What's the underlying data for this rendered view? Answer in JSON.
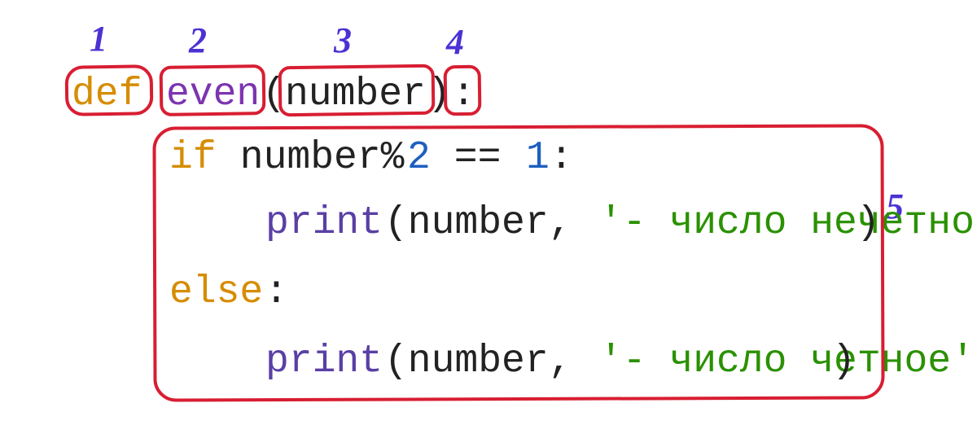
{
  "labels": {
    "l1": "1",
    "l2": "2",
    "l3": "3",
    "l4": "4",
    "l5": "5"
  },
  "code": {
    "def": "def",
    "sp1": " ",
    "fn": "even",
    "lp": "(",
    "arg": "number",
    "rp": ")",
    "colon": ":",
    "if_kw": "if",
    "if_rest": " number%",
    "two": "2",
    "eqeq": " == ",
    "one": "1",
    "if_colon": ":",
    "print1a": "print",
    "print1b": "(number, ",
    "str1": "'- число нечетное'",
    "print1c": ")",
    "else_kw": "else",
    "else_colon": ":",
    "print2a": "print",
    "print2b": "(number, ",
    "str2": "'- число четное'",
    "print2c": ")"
  }
}
